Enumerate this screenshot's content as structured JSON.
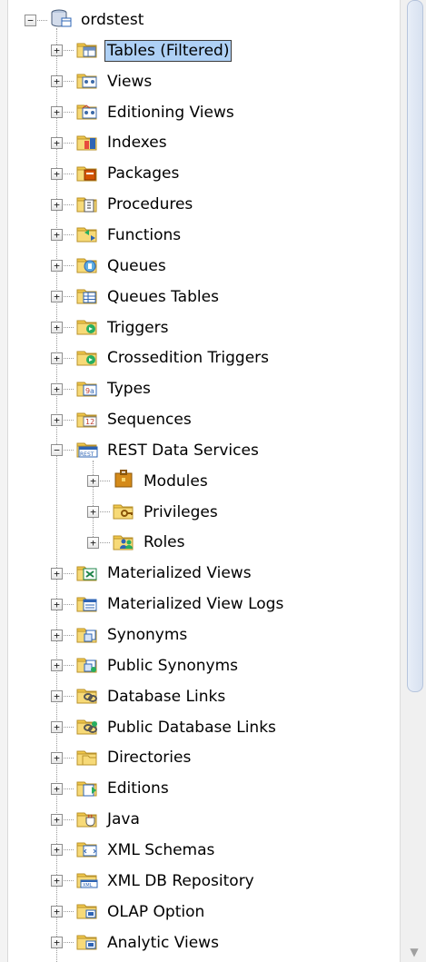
{
  "root": {
    "label": "ordstest",
    "expanded": true,
    "icon": "database-connection-icon"
  },
  "items": [
    {
      "label": "Tables (Filtered)",
      "icon": "tables-folder-icon",
      "selected": true
    },
    {
      "label": "Views",
      "icon": "views-folder-icon"
    },
    {
      "label": "Editioning Views",
      "icon": "editioning-views-folder-icon"
    },
    {
      "label": "Indexes",
      "icon": "indexes-folder-icon"
    },
    {
      "label": "Packages",
      "icon": "packages-folder-icon"
    },
    {
      "label": "Procedures",
      "icon": "procedures-folder-icon"
    },
    {
      "label": "Functions",
      "icon": "functions-folder-icon"
    },
    {
      "label": "Queues",
      "icon": "queues-folder-icon"
    },
    {
      "label": "Queues Tables",
      "icon": "queues-tables-folder-icon"
    },
    {
      "label": "Triggers",
      "icon": "triggers-folder-icon"
    },
    {
      "label": "Crossedition Triggers",
      "icon": "crossedition-triggers-folder-icon"
    },
    {
      "label": "Types",
      "icon": "types-folder-icon"
    },
    {
      "label": "Sequences",
      "icon": "sequences-folder-icon"
    },
    {
      "label": "REST Data Services",
      "icon": "rest-data-services-icon",
      "expanded": true,
      "children": [
        {
          "label": "Modules",
          "icon": "modules-icon"
        },
        {
          "label": "Privileges",
          "icon": "privileges-icon"
        },
        {
          "label": "Roles",
          "icon": "roles-icon"
        }
      ]
    },
    {
      "label": "Materialized Views",
      "icon": "materialized-views-folder-icon"
    },
    {
      "label": "Materialized View Logs",
      "icon": "materialized-view-logs-folder-icon"
    },
    {
      "label": "Synonyms",
      "icon": "synonyms-folder-icon"
    },
    {
      "label": "Public Synonyms",
      "icon": "public-synonyms-folder-icon"
    },
    {
      "label": "Database Links",
      "icon": "database-links-folder-icon"
    },
    {
      "label": "Public Database Links",
      "icon": "public-database-links-folder-icon"
    },
    {
      "label": "Directories",
      "icon": "directories-folder-icon"
    },
    {
      "label": "Editions",
      "icon": "editions-folder-icon"
    },
    {
      "label": "Java",
      "icon": "java-folder-icon"
    },
    {
      "label": "XML Schemas",
      "icon": "xml-schemas-folder-icon"
    },
    {
      "label": "XML DB Repository",
      "icon": "xml-db-repository-folder-icon"
    },
    {
      "label": "OLAP Option",
      "icon": "olap-option-folder-icon"
    },
    {
      "label": "Analytic Views",
      "icon": "analytic-views-folder-icon"
    }
  ],
  "colors": {
    "selection": "#aed0f5",
    "folder": "#f2c94c",
    "tree_line": "#9a9a9a",
    "scroll_thumb": "#d7e1f0"
  }
}
